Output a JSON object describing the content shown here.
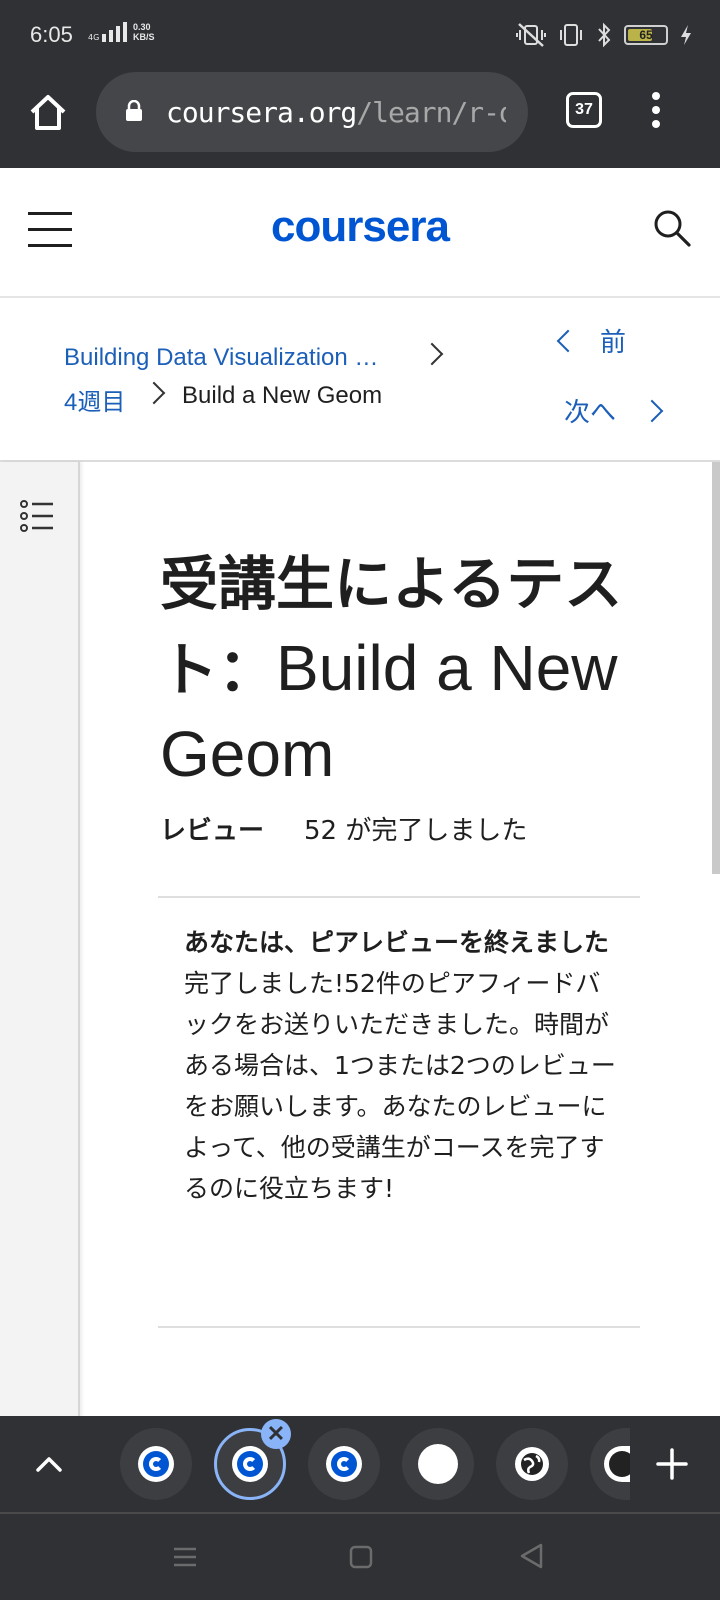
{
  "status_bar": {
    "time": "6:05",
    "network": "4G",
    "speed_value": "0.30",
    "speed_unit": "KB/S",
    "battery": "65"
  },
  "browser": {
    "url_host": "coursera.org",
    "url_path": "/learn/r-dat",
    "tab_count": "37"
  },
  "site": {
    "logo": "coursera"
  },
  "breadcrumb": {
    "course": "Building Data Visualization …",
    "week": "4週目",
    "item": "Build a New Geom"
  },
  "pager": {
    "prev": "前",
    "next": "次へ"
  },
  "assignment": {
    "title_ja": "受講生によるテスト：",
    "title_en": "Build a New Geom",
    "review_label": "レビュー",
    "review_status": "52 が完了しました",
    "notice_heading": "あなたは、ピアレビューを終えました",
    "notice_body": "完了しました!52件のピアフィードバックをお送りいただきました。時間がある場合は、1つまたは2つのレビューをお願いします。あなたのレビューによって、他の受講生がコースを完了するのに役立ちます!"
  },
  "tabs": {
    "close_glyph": "✕"
  }
}
